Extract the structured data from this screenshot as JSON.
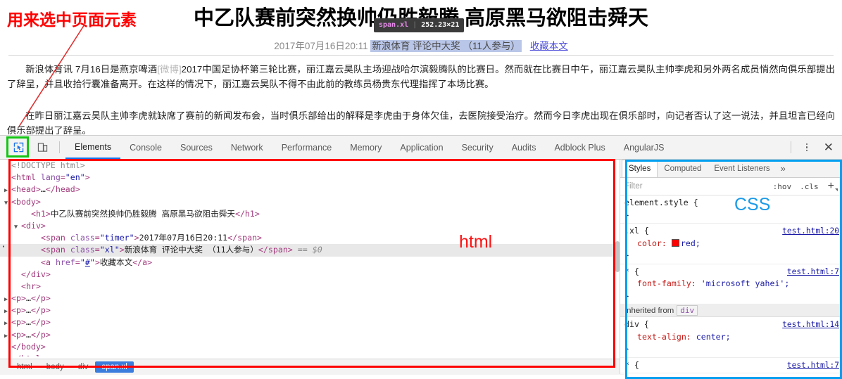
{
  "annotations": {
    "top_left": "用来选中页面元素",
    "html_label": "html",
    "css_label": "CSS"
  },
  "page": {
    "title": "中乙队赛前突然换帅仍胜毅腾 高原黑马欲阻击舜天",
    "timer": "2017年07月16日20:11",
    "source_span": "新浪体育 评论中大奖 （11人参与）",
    "collect_link": "收藏本文",
    "paragraph1_a": "新浪体育讯  7月16日是燕京啤酒",
    "paragraph1_weibo": "[微博]",
    "paragraph1_b": "2017中国足协杯第三轮比赛，丽江嘉云昊队主场迎战哈尔滨毅腾队的比赛日。然而就在比赛日中午，丽江嘉云昊队主帅李虎和另外两名成员悄然向俱乐部提出了辞呈，并且收拾行囊准备离开。在这样的情况下，丽江嘉云昊队不得不由此前的教练员杨贵东代理指挥了本场比赛。",
    "paragraph2": "在昨日丽江嘉云昊队主帅李虎就缺席了赛前的新闻发布会，当时俱乐部给出的解释是李虎由于身体欠佳，去医院接受治疗。然而今日李虎出现在俱乐部时，向记者否认了这一说法，并且坦言已经向俱乐部提出了辞呈。"
  },
  "inspect_tooltip": {
    "selector": "span.xl",
    "divider": "|",
    "dimensions": "252.23×21"
  },
  "devtools": {
    "toolbar_icons": [
      "inspect-element-icon",
      "device-toolbar-icon"
    ],
    "tabs": [
      {
        "label": "Elements",
        "active": true
      },
      {
        "label": "Console",
        "active": false
      },
      {
        "label": "Sources",
        "active": false
      },
      {
        "label": "Network",
        "active": false
      },
      {
        "label": "Performance",
        "active": false
      },
      {
        "label": "Memory",
        "active": false
      },
      {
        "label": "Application",
        "active": false
      },
      {
        "label": "Security",
        "active": false
      },
      {
        "label": "Audits",
        "active": false
      },
      {
        "label": "Adblock Plus",
        "active": false
      },
      {
        "label": "AngularJS",
        "active": false
      }
    ],
    "close_label": "✕",
    "dom_lines": [
      {
        "indent": 0,
        "twisty": "",
        "html": "<span class='doctype'>&lt;!DOCTYPE html&gt;</span>",
        "selected": false
      },
      {
        "indent": 0,
        "twisty": "",
        "html": "<span class='tag'>&lt;html </span><span class='attrname'>lang</span><span class='tag'>=</span><span class='attrval'>\"en\"</span><span class='tag'>&gt;</span>",
        "selected": false
      },
      {
        "indent": 0,
        "twisty": "▶",
        "html": "<span class='tag'>&lt;head&gt;</span><span class='txt'>…</span><span class='tag'>&lt;/head&gt;</span>",
        "selected": false
      },
      {
        "indent": 0,
        "twisty": "▼",
        "html": "<span class='tag'>&lt;body&gt;</span>",
        "selected": false
      },
      {
        "indent": 2,
        "twisty": "",
        "html": "<span class='tag'>&lt;h1&gt;</span><span class='txt'>中乙队赛前突然换帅仍胜毅腾 高原黑马欲阻击舜天</span><span class='tag'>&lt;/h1&gt;</span>",
        "selected": false
      },
      {
        "indent": 1,
        "twisty": "▼",
        "html": "<span class='tag'>&lt;div&gt;</span>",
        "selected": false
      },
      {
        "indent": 3,
        "twisty": "",
        "html": "<span class='tag'>&lt;span </span><span class='attrname'>class</span><span class='tag'>=</span><span class='attrval'>\"timer\"</span><span class='tag'>&gt;</span><span class='txt'>2017年07月16日20:11</span><span class='tag'>&lt;/span&gt;</span>",
        "selected": false
      },
      {
        "indent": 3,
        "twisty": "",
        "html": "<span class='tag'>&lt;span </span><span class='attrname'>class</span><span class='tag'>=</span><span class='attrval'>\"xl\"</span><span class='tag'>&gt;</span><span class='txt'>新浪体育 评论中大奖 （11人参与）</span><span class='tag'>&lt;/span&gt;</span><span class='dollar'> == $0</span>",
        "selected": true
      },
      {
        "indent": 3,
        "twisty": "",
        "html": "<span class='tag'>&lt;a </span><span class='attrname'>href</span><span class='tag'>=</span><span class='attrval'>\"</span><span class='aunder'>#</span><span class='attrval'>\"</span><span class='tag'>&gt;</span><span class='txt'>收藏本文</span><span class='tag'>&lt;/a&gt;</span>",
        "selected": false
      },
      {
        "indent": 1,
        "twisty": "",
        "html": "<span class='tag'>&lt;/div&gt;</span>",
        "selected": false
      },
      {
        "indent": 1,
        "twisty": "",
        "html": "<span class='tag'>&lt;hr&gt;</span>",
        "selected": false
      },
      {
        "indent": 0,
        "twisty": "▶",
        "html": "<span class='tag'>&lt;p&gt;</span><span class='txt'>…</span><span class='tag'>&lt;/p&gt;</span>",
        "selected": false
      },
      {
        "indent": 0,
        "twisty": "▶",
        "html": "<span class='tag'>&lt;p&gt;</span><span class='txt'>…</span><span class='tag'>&lt;/p&gt;</span>",
        "selected": false
      },
      {
        "indent": 0,
        "twisty": "▶",
        "html": "<span class='tag'>&lt;p&gt;</span><span class='txt'>…</span><span class='tag'>&lt;/p&gt;</span>",
        "selected": false
      },
      {
        "indent": 0,
        "twisty": "▶",
        "html": "<span class='tag'>&lt;p&gt;</span><span class='txt'>…</span><span class='tag'>&lt;/p&gt;</span>",
        "selected": false
      },
      {
        "indent": 0,
        "twisty": "",
        "html": "<span class='tag'>&lt;/body&gt;</span>",
        "selected": false
      },
      {
        "indent": -1,
        "twisty": "",
        "html": "<span class='tag'>&lt;/html&gt;</span>",
        "selected": false
      }
    ],
    "breadcrumb": [
      {
        "label": "html",
        "active": false
      },
      {
        "label": "body",
        "active": false
      },
      {
        "label": "div",
        "active": false
      },
      {
        "label": "span.xl",
        "active": true
      }
    ]
  },
  "styles": {
    "tabs": [
      {
        "label": "Styles",
        "active": true
      },
      {
        "label": "Computed",
        "active": false
      },
      {
        "label": "Event Listeners",
        "active": false
      }
    ],
    "more_label": "»",
    "filter_placeholder": "Filter",
    "hov_label": ":hov",
    "cls_label": ".cls",
    "plus_label": "+",
    "rules": [
      {
        "selector": "element.style {",
        "close": "}",
        "source": "",
        "props": []
      },
      {
        "selector": ".xl {",
        "close": "}",
        "source": "test.html:20",
        "props": [
          {
            "name": "color:",
            "value": "red;",
            "swatch": "#ff0000"
          }
        ]
      },
      {
        "selector": "* {",
        "close": "}",
        "source": "test.html:7",
        "props": [
          {
            "name": "font-family:",
            "value": "'microsoft yahei';",
            "swatch": ""
          }
        ]
      }
    ],
    "inherited_label": "Inherited from",
    "inherited_tag": "div",
    "inherited_rules": [
      {
        "selector": "div {",
        "close": "}",
        "source": "test.html:14",
        "props": [
          {
            "name": "text-align:",
            "value": "center;",
            "swatch": ""
          }
        ]
      },
      {
        "selector": "* {",
        "close": "",
        "source": "test.html:7",
        "props": []
      }
    ]
  }
}
